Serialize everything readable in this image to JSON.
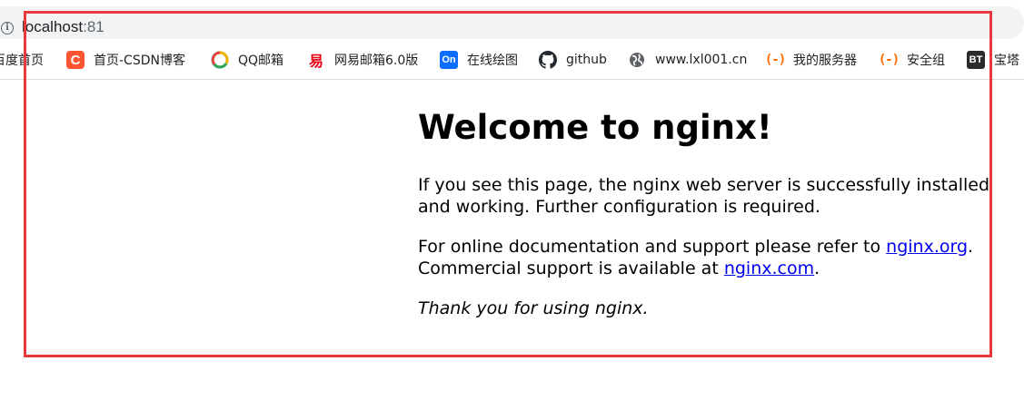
{
  "address_bar": {
    "host": "localhost",
    "port": ":81",
    "info_icon": "info-icon"
  },
  "bookmarks": [
    {
      "label": "百度首页",
      "icon": "none"
    },
    {
      "label": "首页-CSDN博客",
      "icon": "csdn-icon",
      "glyph": "C"
    },
    {
      "label": "QQ邮箱",
      "icon": "qq-mail-icon"
    },
    {
      "label": "网易邮箱6.0版",
      "icon": "netease-mail-icon",
      "glyph": "易"
    },
    {
      "label": "在线绘图",
      "icon": "processon-icon",
      "glyph": "On"
    },
    {
      "label": "github",
      "icon": "github-icon"
    },
    {
      "label": "www.lxl001.cn",
      "icon": "globe-icon"
    },
    {
      "label": "我的服务器",
      "icon": "aliyun-icon",
      "glyph": "(-)"
    },
    {
      "label": "安全组",
      "icon": "aliyun-icon",
      "glyph": "(-)"
    },
    {
      "label": "宝塔",
      "icon": "bt-icon",
      "glyph": "BT"
    }
  ],
  "content": {
    "title": "Welcome to nginx!",
    "p1": "If you see this page, the nginx web server is successfully installed and working. Further configuration is required.",
    "p2_prefix": "For online documentation and support please refer to ",
    "link_org": "nginx.org",
    "p2_mid": ".",
    "p2_line2": "Commercial support is available at ",
    "link_com": "nginx.com",
    "p2_end": ".",
    "thanks": "Thank you for using nginx."
  },
  "colors": {
    "highlight": "#e83a3a",
    "link": "#0000ee",
    "url_bar_bg": "#f1f3f4"
  }
}
